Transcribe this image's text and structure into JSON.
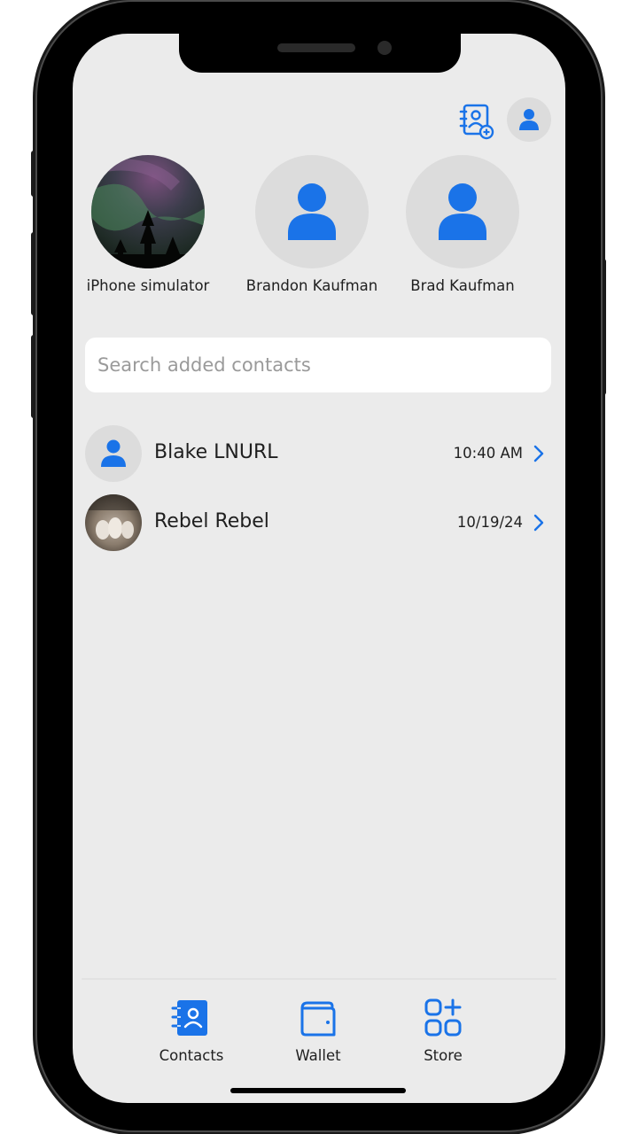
{
  "colors": {
    "accent": "#1a73e8",
    "screen_bg": "#ebebeb",
    "avatar_bg": "#dcdcdc"
  },
  "header": {
    "add_contact_icon": "address-book-plus-icon",
    "profile_icon": "person-icon"
  },
  "pinned_contacts": [
    {
      "name": "iPhone simulator",
      "avatar": "aurora-photo"
    },
    {
      "name": "Brandon Kaufman",
      "avatar": "person-icon"
    },
    {
      "name": "Brad Kaufman",
      "avatar": "person-icon"
    }
  ],
  "search": {
    "placeholder": "Search added contacts",
    "value": ""
  },
  "contacts": [
    {
      "name": "Blake LNURL",
      "time": "10:40 AM",
      "avatar": "person-icon"
    },
    {
      "name": "Rebel Rebel",
      "time": "10/19/24",
      "avatar": "photo"
    }
  ],
  "nav": {
    "items": [
      {
        "label": "Contacts",
        "icon": "contacts-book-icon",
        "active": true
      },
      {
        "label": "Wallet",
        "icon": "wallet-icon",
        "active": false
      },
      {
        "label": "Store",
        "icon": "apps-grid-plus-icon",
        "active": false
      }
    ]
  }
}
